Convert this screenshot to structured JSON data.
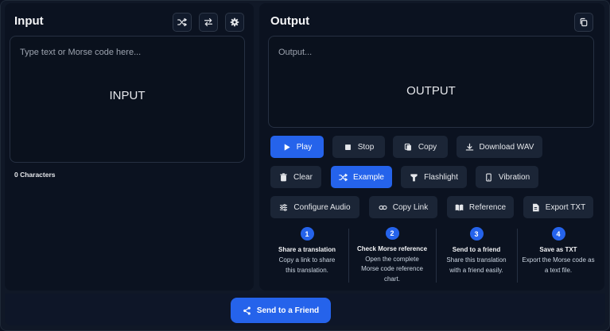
{
  "input": {
    "title": "Input",
    "placeholder": "Type text or Morse code here...",
    "label": "INPUT",
    "char_count": "0 Characters",
    "icons": [
      "shuffle-icon",
      "swap-icon",
      "gear-icon"
    ]
  },
  "output": {
    "title": "Output",
    "placeholder": "Output...",
    "label": "OUTPUT",
    "copy_icon": "copy-icon"
  },
  "buttons": {
    "play": "Play",
    "stop": "Stop",
    "copy": "Copy",
    "download_wav": "Download WAV",
    "clear": "Clear",
    "example": "Example",
    "flashlight": "Flashlight",
    "vibration": "Vibration",
    "configure_audio": "Configure Audio",
    "copy_link": "Copy Link",
    "reference": "Reference",
    "export_txt": "Export TXT"
  },
  "steps": [
    {
      "num": "1",
      "title": "Share a translation",
      "desc": "Copy a link to share this translation."
    },
    {
      "num": "2",
      "title": "Check Morse reference",
      "desc": "Open the complete Morse code reference chart."
    },
    {
      "num": "3",
      "title": "Send to a friend",
      "desc": "Share this translation with a friend easily."
    },
    {
      "num": "4",
      "title": "Save as TXT",
      "desc": "Export the Morse code as a text file."
    }
  ],
  "send_button": "Send to a Friend",
  "colors": {
    "accent": "#2563eb",
    "panel": "#0b1220",
    "button": "#1b2536"
  }
}
